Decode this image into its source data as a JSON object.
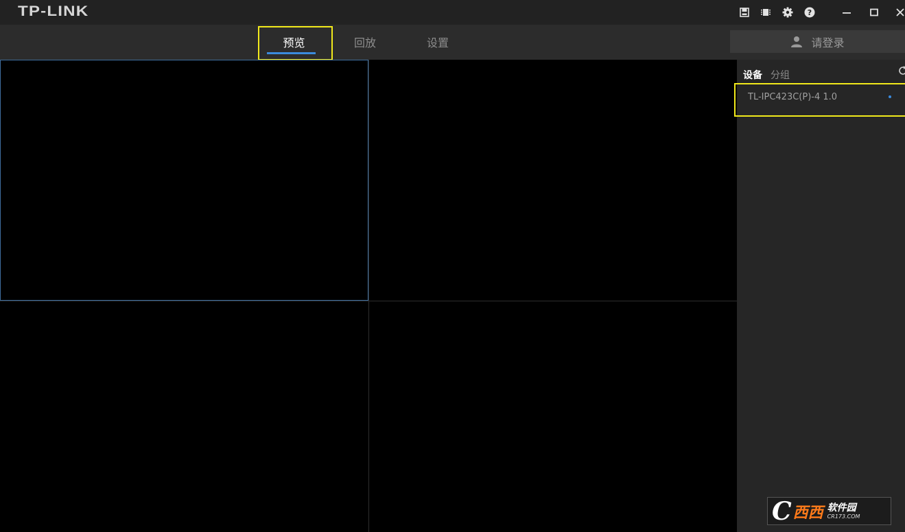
{
  "app": {
    "logo": "TP-LINK"
  },
  "titlebar": {
    "icons": [
      "save-icon",
      "cpu-icon",
      "gear-icon",
      "help-icon",
      "minimize-icon",
      "maximize-icon",
      "close-icon"
    ]
  },
  "nav": {
    "tabs": [
      {
        "label": "预览",
        "active": true
      },
      {
        "label": "回放",
        "active": false
      },
      {
        "label": "设置",
        "active": false
      }
    ],
    "login_label": "请登录"
  },
  "side_panel": {
    "tabs": [
      {
        "label": "设备",
        "active": true
      },
      {
        "label": "分组",
        "active": false
      }
    ],
    "devices": [
      {
        "name": "TL-IPC423C(P)-4 1.0",
        "status_color": "#3b8bdd"
      }
    ]
  },
  "video_grid": {
    "layout": "2x2",
    "selected_index": 0
  },
  "watermark": {
    "main": "西西",
    "soft": "软件园",
    "url": "CR173.COM"
  },
  "colors": {
    "accent": "#3b8bdd",
    "highlight_box": "#f2ea1b"
  }
}
